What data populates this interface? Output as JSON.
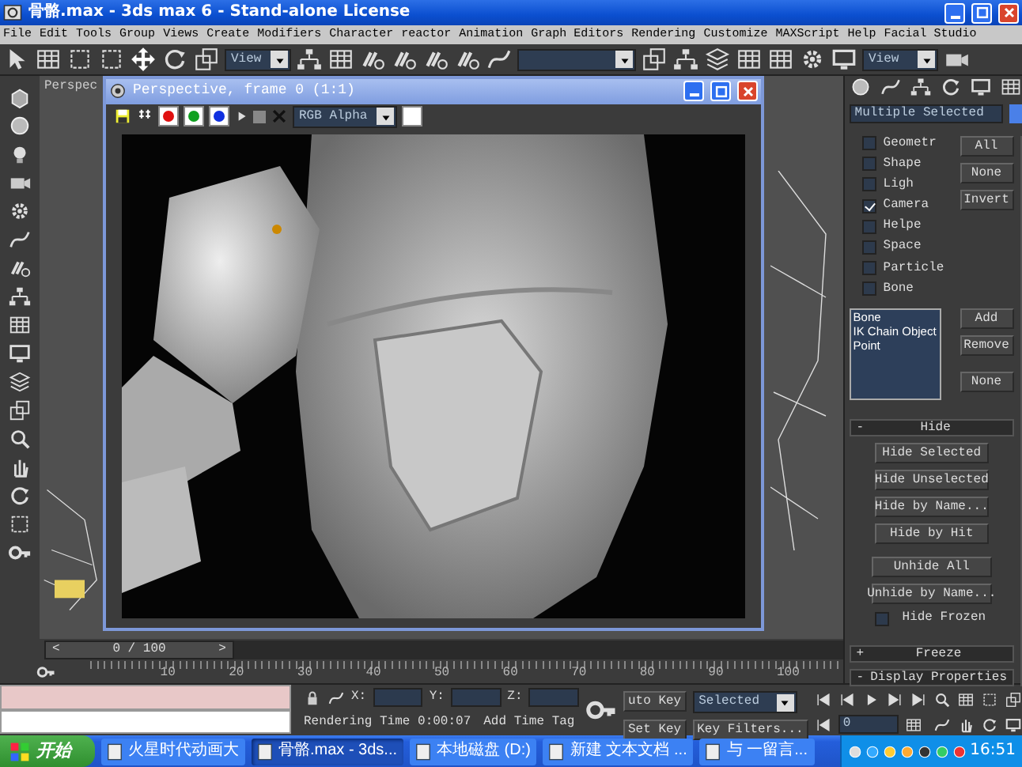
{
  "window": {
    "title": "骨骼.max - 3ds max 6 - Stand-alone License"
  },
  "menu": [
    "File",
    "Edit",
    "Tools",
    "Group",
    "Views",
    "Create",
    "Modifiers",
    "Character",
    "reactor",
    "Animation",
    "Graph Editors",
    "Rendering",
    "Customize",
    "MAXScript",
    "Help",
    "Facial Studio"
  ],
  "toolbar": {
    "view_dropdowns": [
      "View",
      "View"
    ]
  },
  "viewport": {
    "label": "Perspec"
  },
  "render_window": {
    "title": "Perspective, frame 0 (1:1)",
    "channel_select": "RGB Alpha",
    "channels": [
      {
        "color": "#e01010"
      },
      {
        "color": "#10a020"
      },
      {
        "color": "#1030e0"
      }
    ]
  },
  "command_panel": {
    "name_field": "Multiple Selected",
    "categories": [
      {
        "label": "Geometr",
        "checked": false
      },
      {
        "label": "Shape",
        "checked": false
      },
      {
        "label": "Ligh",
        "checked": false
      },
      {
        "label": "Camera",
        "checked": true
      },
      {
        "label": "Helpe",
        "checked": false
      },
      {
        "label": "Space",
        "checked": false
      },
      {
        "label": "Particle",
        "checked": false
      },
      {
        "label": "Bone",
        "checked": false
      }
    ],
    "category_buttons": [
      "All",
      "None",
      "Invert"
    ],
    "list_items": [
      "Bone",
      "IK Chain Object",
      "Point"
    ],
    "list_buttons": [
      "Add",
      "Remove",
      "None"
    ],
    "hide_rollout": {
      "sign": "-",
      "title": "Hide",
      "buttons": [
        "Hide Selected",
        "Hide Unselected",
        "Hide by Name...",
        "Hide by Hit"
      ],
      "unhide_buttons": [
        "Unhide All",
        "Unhide by Name..."
      ],
      "hide_frozen": {
        "label": "Hide Frozen",
        "checked": false
      }
    },
    "rollouts": [
      {
        "sign": "+",
        "title": "Freeze"
      },
      {
        "sign": "-",
        "title": "Display Properties"
      }
    ]
  },
  "time_slider": {
    "label": "0 / 100",
    "prev": "<",
    "next": ">",
    "level": 0
  },
  "track_ruler": {
    "labels": [
      "10",
      "20",
      "30",
      "40",
      "50",
      "60",
      "70",
      "80",
      "90",
      "100"
    ]
  },
  "status": {
    "coords": [
      "X:",
      "Y:",
      "Z:"
    ],
    "rendering_time": "Rendering Time  0:00:07",
    "add_time_tag": "Add Time Tag",
    "auto_key": "uto Key",
    "key_mode": "Selected",
    "set_key": "Set Key",
    "key_filters": "Key Filters...",
    "frame": "0"
  },
  "taskbar": {
    "start": "开始",
    "clock": "16:51",
    "tasks": [
      {
        "label": "火星时代动画大",
        "selected": false
      },
      {
        "label": "骨骼.max - 3ds...",
        "selected": true
      },
      {
        "label": "本地磁盘 (D:)",
        "selected": false
      },
      {
        "label": "新建 文本文档 ...",
        "selected": false
      },
      {
        "label": "与 一留言...",
        "selected": false
      }
    ]
  }
}
